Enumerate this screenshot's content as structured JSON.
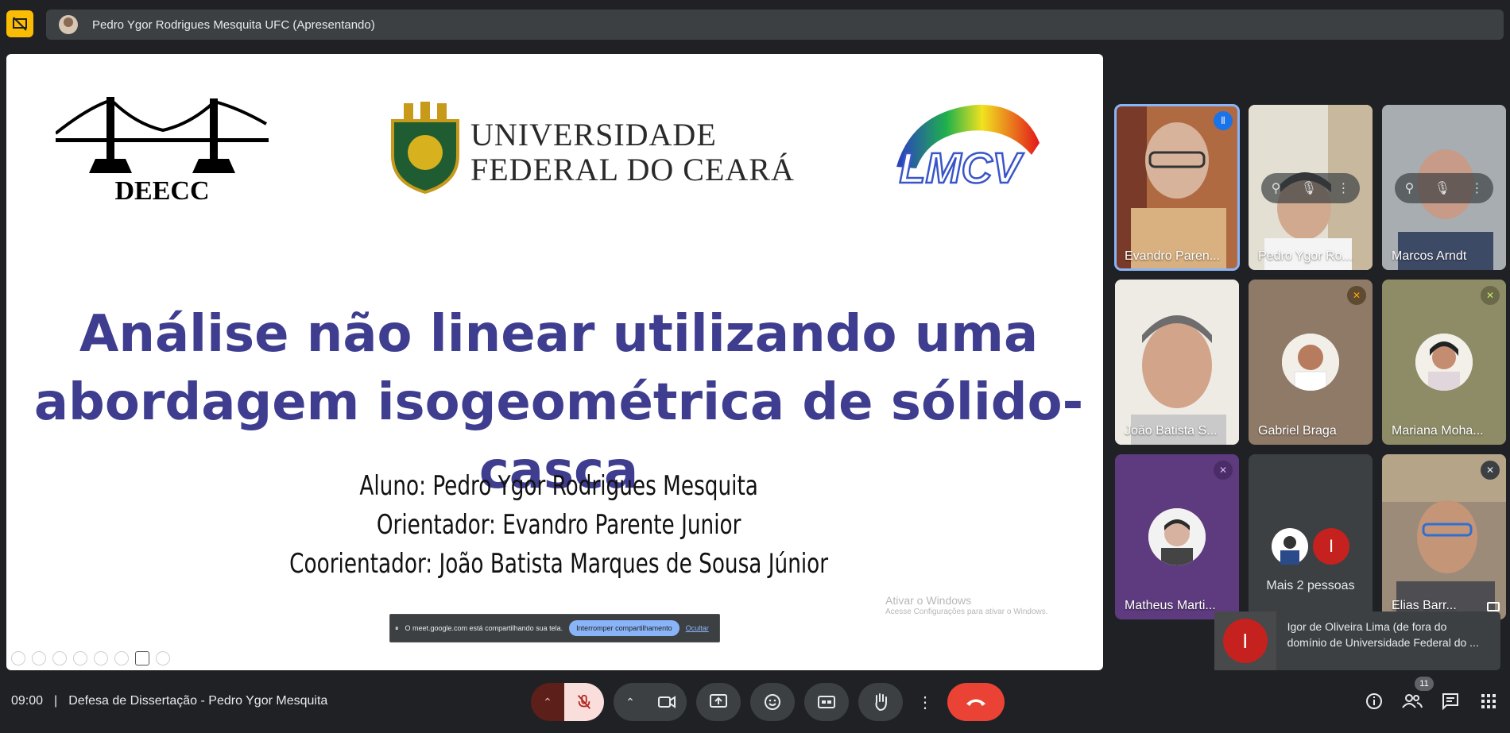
{
  "presenter": {
    "label": "Pedro Ygor Rodrigues Mesquita UFC (Apresentando)"
  },
  "slide": {
    "logo_left": "DEECC",
    "university_line1": "UNIVERSIDADE",
    "university_line2": "FEDERAL DO CEARÁ",
    "logo_right": "LMCV",
    "title_line1": "Análise não linear utilizando uma",
    "title_line2": "abordagem isogeométrica de sólido-casca",
    "student": "Aluno: Pedro Ygor Rodrigues Mesquita",
    "advisor": "Orientador: Evandro Parente Junior",
    "coadvisor": "Coorientador: João Batista Marques de Sousa Júnior",
    "watermark_title": "Ativar o Windows",
    "watermark_sub": "Acesse Configurações para ativar o Windows.",
    "share_text": "O meet.google.com está compartilhando sua tela.",
    "share_stop": "Interromper compartilhamento",
    "share_hide": "Ocultar"
  },
  "participants": [
    {
      "name": "Evandro Paren..."
    },
    {
      "name": "Pedro Ygor Ro..."
    },
    {
      "name": "Marcos Arndt"
    },
    {
      "name": "João Batista S..."
    },
    {
      "name": "Gabriel Braga"
    },
    {
      "name": "Mariana Moha..."
    },
    {
      "name": "Matheus Marti..."
    },
    {
      "name": "Mais 2 pessoas"
    },
    {
      "name": "Elias Barr..."
    }
  ],
  "more_avatar_letter": "I",
  "toast": {
    "letter": "I",
    "text": "Igor de Oliveira Lima (de fora do domínio de Universidade Federal do ..."
  },
  "meeting": {
    "time": "09:00",
    "separator": "|",
    "title": "Defesa de Dissertação - Pedro Ygor Mesquita"
  },
  "people_count": "11",
  "colors": {
    "accent": "#8ab4f8",
    "end_call": "#ea4335",
    "title": "#3f3d8f",
    "presenting": "#fbbc04"
  }
}
